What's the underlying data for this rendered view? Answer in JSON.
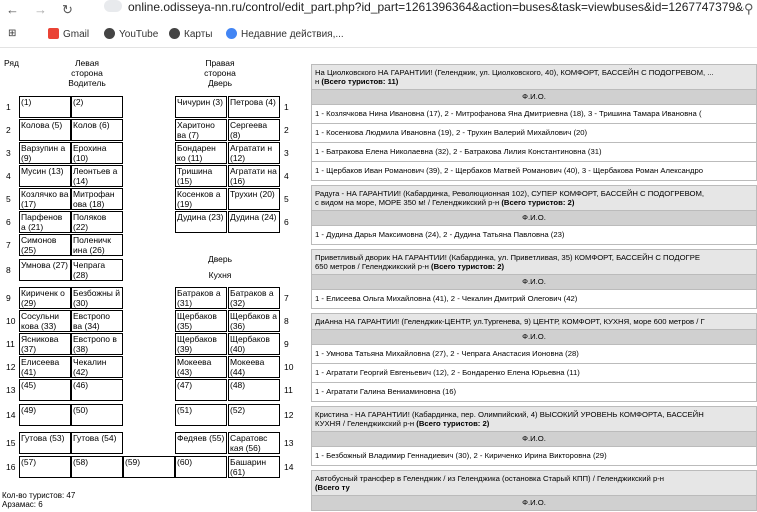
{
  "browser": {
    "url": "online.odisseya-nn.ru/control/edit_part.php?id_part=1261396364&action=buses&task=viewbuses&id=1267747379&ac...",
    "bookmarks": [
      "Gmail",
      "YouTube",
      "Карты",
      "Недавние действия,..."
    ]
  },
  "bus": {
    "row_header": "Ряд",
    "left_header": "Левая сторона Водитель",
    "right_header": "Правая сторона Дверь",
    "door_label": "Дверь",
    "kitchen_label": "Кухня",
    "row_numbers": [
      "1",
      "2",
      "3",
      "4",
      "5",
      "6",
      "7",
      "8",
      "9",
      "10",
      "11",
      "12",
      "13",
      "14",
      "15",
      "16"
    ],
    "right_row_numbers": [
      "1",
      "2",
      "3",
      "4",
      "5",
      "6",
      "7",
      "8",
      "9",
      "10",
      "11",
      "12",
      "13",
      "14"
    ],
    "left_pairs": [
      [
        "(1)",
        "(2)"
      ],
      [
        "Колова (5)",
        "Колов (6)"
      ],
      [
        "Варзупин а (9)",
        "Ерохина (10)"
      ],
      [
        "Мусин (13)",
        "Леонтьев а (14)"
      ],
      [
        "Козлячко ва (17)",
        "Митрофан ова (18)"
      ],
      [
        "Парфенов а (21)",
        "Поляков (22)"
      ],
      [
        "Симонов (25)",
        "Поленичк ина (26)"
      ],
      [
        "Умнова (27)",
        "Чепрага (28)"
      ],
      [
        "Кириченк о (29)",
        "Безбожны й (30)"
      ],
      [
        "Сосульни кова (33)",
        "Евстропо ва (34)"
      ],
      [
        "Ясникова (37)",
        "Евстропо в (38)"
      ],
      [
        "Елисеева (41)",
        "Чекалин (42)"
      ],
      [
        "(45)",
        "(46)"
      ],
      [
        "(49)",
        "(50)"
      ],
      [
        "Гутова (53)",
        "Гутова (54)"
      ],
      [
        "(57)",
        "(58)",
        "(59)"
      ]
    ],
    "right_pairs_top": [
      [
        "Чичурин (3)",
        "Петрова (4)"
      ],
      [
        "Харитоно ва (7)",
        "Сергеева (8)"
      ],
      [
        "Бондарен ко (11)",
        "Агратати н (12)"
      ],
      [
        "Тришина (15)",
        "Агратати на (16)"
      ],
      [
        "Косенков а (19)",
        "Трухин (20)"
      ],
      [
        "Дудина (23)",
        "Дудина (24)"
      ]
    ],
    "right_pairs_bottom": [
      [
        "Батраков а (31)",
        "Батраков а (32)"
      ],
      [
        "Щербаков (35)",
        "Щербаков а (36)"
      ],
      [
        "Щербаков (39)",
        "Щербаков (40)"
      ],
      [
        "Мокеева (43)",
        "Мокеева (44)"
      ],
      [
        "(47)",
        "(48)"
      ],
      [
        "(51)",
        "(52)"
      ],
      [
        "Федяев (55)",
        "Саратовс кая (56)"
      ],
      [
        "(60)",
        "Башарин (61)"
      ]
    ],
    "footer": [
      "Кол-во туристов: 47",
      "Арзамас: 6"
    ]
  },
  "hotels": [
    {
      "title": "На Циолковского НА ГАРАНТИИ! (Геленджик, ул. Циолковского, 40), КОМФОРТ, БАССЕЙН С ПОДОГРЕВОМ, ...",
      "title2": "н",
      "total": "(Всего туристов: 11)",
      "fio": "Ф.И.О.",
      "rows": [
        "1 - Козлячкова Нина Ивановна (17), 2 - Митрофанова Яна Дмитриевна (18), 3 - Тришина Тамара Ивановна (",
        "1 - Косенкова Людмила Ивановна (19), 2 - Трухин Валерий Михайлович (20)",
        "1 - Батракова Елена Николаевна (32), 2 - Батракова Лилия Константиновна (31)",
        "1 - Щербаков Иван Романович (39), 2 - Щербаков Матвей Романович (40), 3 - Щербакова Роман Александро"
      ]
    },
    {
      "title": "Радуга - НА ГАРАНТИИ! (Кабардинка, Революционная 102), СУПЕР КОМФОРТ, БАССЕЙН С ПОДОГРЕВОМ,",
      "title2": "с видом на море, МОРЕ 350 м! / Геленджикский р-н",
      "total": "(Всего туристов: 2)",
      "fio": "Ф.И.О.",
      "rows": [
        "1 - Дудина Дарья Максимовна (24), 2 - Дудина Татьяна Павловна (23)"
      ]
    },
    {
      "title": "Приветливый дворик НА ГАРАНТИИ! (Кабардинка, ул. Приветливая, 35) КОМФОРТ, БАССЕЙН С ПОДОГРЕ",
      "title2": "650 метров / Геленджикский р-н",
      "total": "(Всего туристов: 2)",
      "fio": "Ф.И.О.",
      "rows": [
        "1 - Елисеева Ольга Михайловна (41), 2 - Чекалин Дмитрий Олегович (42)"
      ]
    },
    {
      "title": "ДиАнна НА ГАРАНТИИ! (Геленджик-ЦЕНТР, ул.Тургенева, 9) ЦЕНТР, КОМФОРТ, КУХНЯ, море 600 метров / Г",
      "title2": "",
      "total": "",
      "fio": "Ф.И.О.",
      "rows": [
        "1 - Умнова Татьяна Михайловна (27), 2 - Чепрага Анастасия Ионовна (28)",
        "1 - Агратати Георгий Евгеньевич (12), 2 - Бондаренко Елена Юрьевна (11)",
        "1 - Агратати Галина Вениаминовна (16)"
      ]
    },
    {
      "title": "Кристина - НА ГАРАНТИИ! (Кабардинка, пер. Олимпийский, 4) ВЫСОКИЙ УРОВЕНЬ КОМФОРТА, БАССЕЙН",
      "title2": "КУХНЯ / Геленджикский р-н",
      "total": "(Всего туристов: 2)",
      "fio": "Ф.И.О.",
      "rows": [
        "1 - Безбожный Владимир Геннадиевич (30), 2 - Кириченко Ирина Викторовна (29)"
      ]
    },
    {
      "title": "Автобусный трансфер в Геленджик / из Геленджика (остановка Старый КПП) / Геленджикский р-н",
      "title2": "",
      "total": "(Всего ту",
      "fio": "Ф.И.О.",
      "rows": []
    }
  ]
}
